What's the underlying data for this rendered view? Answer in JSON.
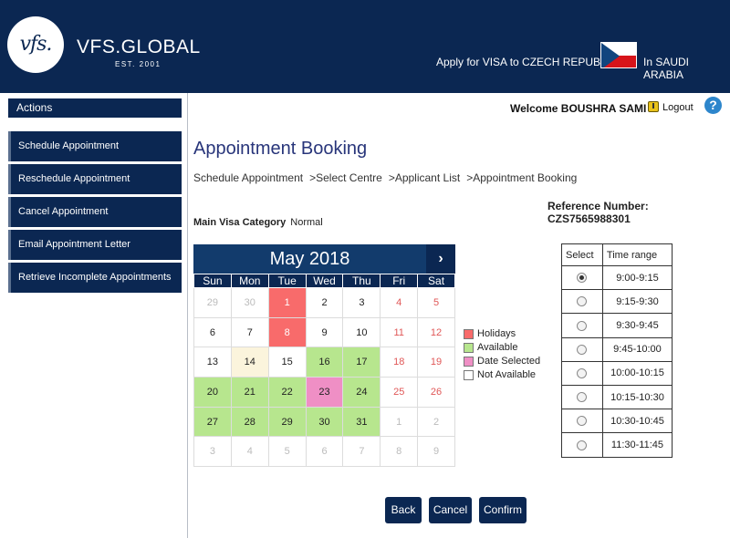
{
  "header": {
    "logo_text": "vfs.",
    "brand": "VFS.GLOBAL",
    "est": "EST. 2001",
    "apply_text": "Apply for VISA to CZECH REPUBLIC",
    "country_text": "In SAUDI ARABIA",
    "flag_icon": "czech-flag-icon"
  },
  "user": {
    "welcome": "Welcome BOUSHRA SAMI !",
    "logout": "Logout",
    "help": "?"
  },
  "sidebar": {
    "header": "Actions",
    "items": [
      {
        "label": "Schedule Appointment"
      },
      {
        "label": "Reschedule Appointment"
      },
      {
        "label": "Cancel Appointment"
      },
      {
        "label": "Email Appointment Letter"
      },
      {
        "label": "Retrieve Incomplete Appointments"
      }
    ]
  },
  "main": {
    "title": "Appointment Booking",
    "breadcrumb": [
      "Schedule Appointment",
      "Select Centre",
      "Applicant List",
      "Appointment Booking"
    ],
    "breadcrumb_sep": ">",
    "reference": "Reference Number: CZS7565988301",
    "visa_category_label": "Main Visa Category",
    "visa_category_value": "Normal"
  },
  "calendar": {
    "month": "May 2018",
    "next_icon": "chevron-right-icon",
    "next_symbol": "›",
    "weekdays": [
      "Sun",
      "Mon",
      "Tue",
      "Wed",
      "Thu",
      "Fri",
      "Sat"
    ],
    "weeks": [
      [
        {
          "d": "29",
          "s": "muted"
        },
        {
          "d": "30",
          "s": "muted"
        },
        {
          "d": "1",
          "s": "holiday"
        },
        {
          "d": "2",
          "s": "plain"
        },
        {
          "d": "3",
          "s": "plain"
        },
        {
          "d": "4",
          "s": "weekend"
        },
        {
          "d": "5",
          "s": "weekend"
        }
      ],
      [
        {
          "d": "6",
          "s": "plain"
        },
        {
          "d": "7",
          "s": "plain"
        },
        {
          "d": "8",
          "s": "holiday"
        },
        {
          "d": "9",
          "s": "plain"
        },
        {
          "d": "10",
          "s": "plain"
        },
        {
          "d": "11",
          "s": "weekend"
        },
        {
          "d": "12",
          "s": "weekend"
        }
      ],
      [
        {
          "d": "13",
          "s": "plain"
        },
        {
          "d": "14",
          "s": "today"
        },
        {
          "d": "15",
          "s": "plain"
        },
        {
          "d": "16",
          "s": "avail"
        },
        {
          "d": "17",
          "s": "avail"
        },
        {
          "d": "18",
          "s": "weekend"
        },
        {
          "d": "19",
          "s": "weekend"
        }
      ],
      [
        {
          "d": "20",
          "s": "avail"
        },
        {
          "d": "21",
          "s": "avail"
        },
        {
          "d": "22",
          "s": "avail"
        },
        {
          "d": "23",
          "s": "selected"
        },
        {
          "d": "24",
          "s": "avail"
        },
        {
          "d": "25",
          "s": "weekend"
        },
        {
          "d": "26",
          "s": "weekend"
        }
      ],
      [
        {
          "d": "27",
          "s": "avail"
        },
        {
          "d": "28",
          "s": "avail"
        },
        {
          "d": "29",
          "s": "avail"
        },
        {
          "d": "30",
          "s": "avail"
        },
        {
          "d": "31",
          "s": "avail"
        },
        {
          "d": "1",
          "s": "muted"
        },
        {
          "d": "2",
          "s": "muted"
        }
      ],
      [
        {
          "d": "3",
          "s": "muted"
        },
        {
          "d": "4",
          "s": "muted"
        },
        {
          "d": "5",
          "s": "muted"
        },
        {
          "d": "6",
          "s": "muted"
        },
        {
          "d": "7",
          "s": "muted"
        },
        {
          "d": "8",
          "s": "muted"
        },
        {
          "d": "9",
          "s": "muted"
        }
      ]
    ]
  },
  "legend": [
    {
      "label": "Holidays",
      "color": "#f86b6b"
    },
    {
      "label": "Available",
      "color": "#b7e68e"
    },
    {
      "label": "Date Selected",
      "color": "#ef8fc5"
    },
    {
      "label": "Not Available",
      "color": "#ffffff"
    }
  ],
  "time_slots": {
    "headers": [
      "Select",
      "Time range"
    ],
    "rows": [
      {
        "range": "9:00-9:15",
        "selected": true
      },
      {
        "range": "9:15-9:30",
        "selected": false
      },
      {
        "range": "9:30-9:45",
        "selected": false
      },
      {
        "range": "9:45-10:00",
        "selected": false
      },
      {
        "range": "10:00-10:15",
        "selected": false
      },
      {
        "range": "10:15-10:30",
        "selected": false
      },
      {
        "range": "10:30-10:45",
        "selected": false
      },
      {
        "range": "11:30-11:45",
        "selected": false
      }
    ]
  },
  "buttons": {
    "back": "Back",
    "cancel": "Cancel",
    "confirm": "Confirm"
  },
  "colors": {
    "navy": "#0b2752",
    "title_blue": "#28357a",
    "holiday": "#f86b6b",
    "available": "#b7e68e",
    "selected": "#ef8fc5"
  }
}
